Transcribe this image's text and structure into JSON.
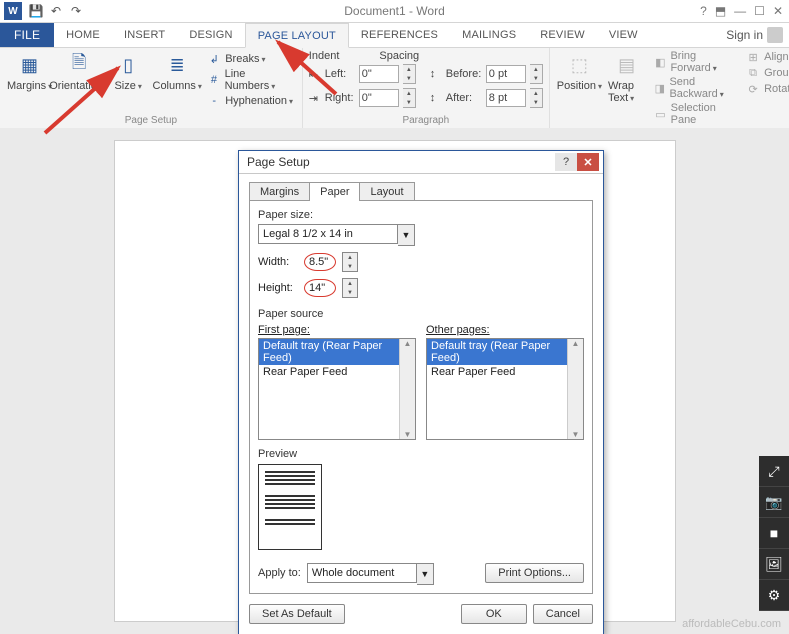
{
  "app": {
    "title": "Document1 - Word",
    "sign_in": "Sign in"
  },
  "qat": {
    "save": "💾",
    "undo": "↶",
    "redo": "↷"
  },
  "tabs": {
    "file": "FILE",
    "home": "HOME",
    "insert": "INSERT",
    "design": "DESIGN",
    "page_layout": "PAGE LAYOUT",
    "references": "REFERENCES",
    "mailings": "MAILINGS",
    "review": "REVIEW",
    "view": "VIEW"
  },
  "active_tab": "page_layout",
  "ribbon": {
    "page_setup": {
      "title": "Page Setup",
      "margins": "Margins",
      "orientation": "Orientation",
      "size": "Size",
      "columns": "Columns",
      "breaks": "Breaks",
      "line_numbers": "Line Numbers",
      "hyphenation": "Hyphenation"
    },
    "paragraph": {
      "title": "Paragraph",
      "indent": "Indent",
      "spacing": "Spacing",
      "left": "Left:",
      "right": "Right:",
      "before": "Before:",
      "after": "After:",
      "left_val": "0\"",
      "right_val": "0\"",
      "before_val": "0 pt",
      "after_val": "8 pt"
    },
    "arrange": {
      "title": "Arrange",
      "position": "Position",
      "wrap_text": "Wrap Text",
      "bring_forward": "Bring Forward",
      "send_backward": "Send Backward",
      "selection_pane": "Selection Pane",
      "align": "Align",
      "group": "Group",
      "rotate": "Rotate"
    }
  },
  "dialog": {
    "title": "Page Setup",
    "tabs": {
      "margins": "Margins",
      "paper": "Paper",
      "layout": "Layout"
    },
    "active_tab": "paper",
    "paper_size_label": "Paper size:",
    "paper_size_value": "Legal 8 1/2 x 14 in",
    "width_label": "Width:",
    "width_value": "8.5\"",
    "height_label": "Height:",
    "height_value": "14\"",
    "paper_source_label": "Paper source",
    "first_page": "First page:",
    "other_pages": "Other pages:",
    "tray_default": "Default tray (Rear Paper Feed)",
    "tray_rear": "Rear Paper Feed",
    "preview": "Preview",
    "apply_to": "Apply to:",
    "apply_val": "Whole document",
    "print_options": "Print Options...",
    "set_default": "Set As Default",
    "ok": "OK",
    "cancel": "Cancel"
  },
  "watermark": "affordableCebu.com"
}
